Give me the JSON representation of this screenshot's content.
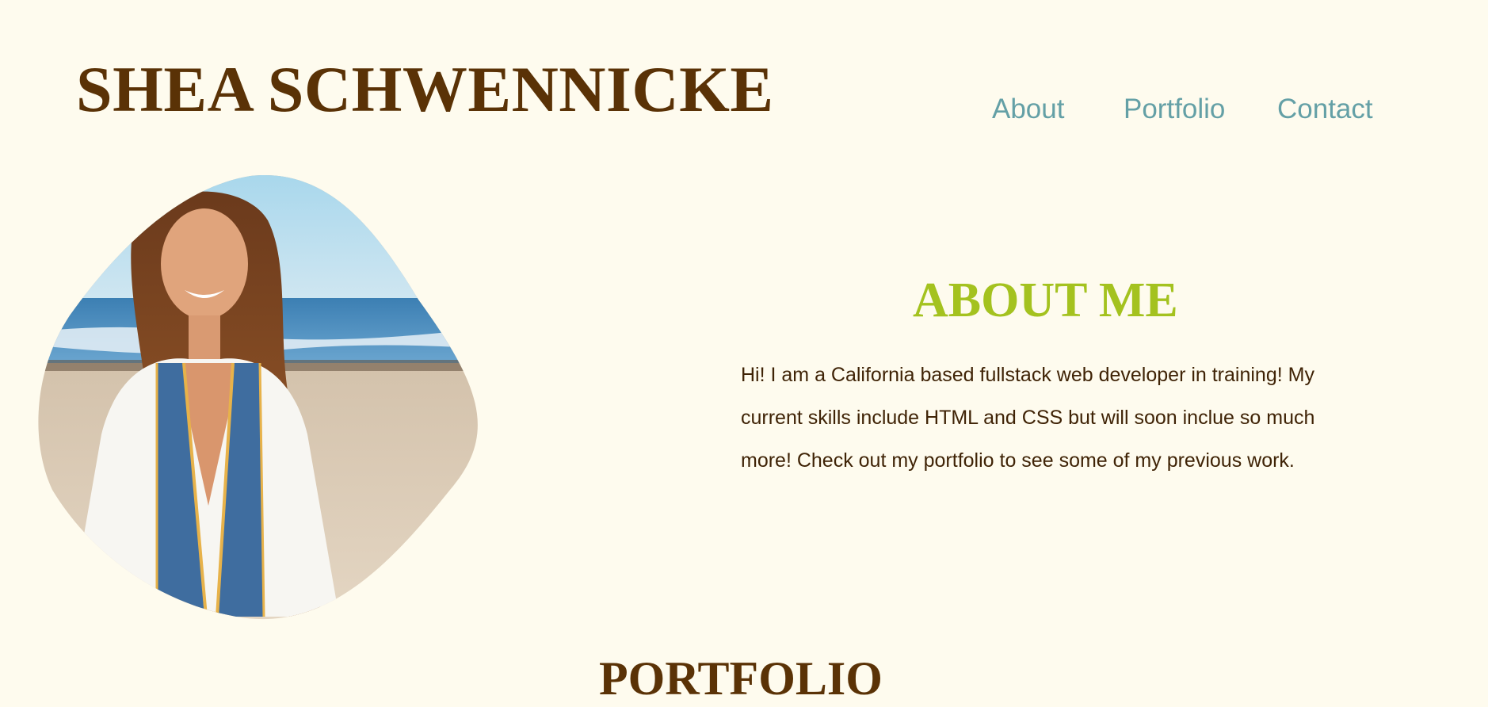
{
  "header": {
    "site_title": "SHEA SCHWENNICKE"
  },
  "nav": {
    "items": [
      {
        "label": "About"
      },
      {
        "label": "Portfolio"
      },
      {
        "label": "Contact"
      }
    ]
  },
  "about": {
    "heading": "ABOUT ME",
    "body": "Hi! I am a California based fullstack web developer in training! My current skills include HTML and CSS but will soon inclue so much more! Check out my portfolio to see some of my previous work."
  },
  "portfolio": {
    "heading": "PORTFOLIO"
  },
  "colors": {
    "background": "#fefbee",
    "title_brown": "#5a3206",
    "nav_teal": "#64a0a6",
    "accent_green": "#a4c21f",
    "body_text": "#3f2306"
  }
}
